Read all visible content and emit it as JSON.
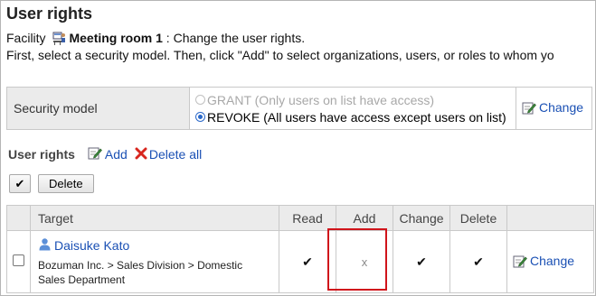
{
  "page": {
    "title": "User rights",
    "facility_label": "Facility",
    "facility_name": "Meeting room 1",
    "facility_suffix": " : Change the user rights.",
    "instruction": "First, select a security model. Then, click \"Add\" to select organizations, users, or roles to whom yo"
  },
  "security_model": {
    "label": "Security model",
    "option_grant": "GRANT (Only users on list have access)",
    "option_revoke": "REVOKE (All users have access except users on list)",
    "selected": "REVOKE",
    "change_label": "Change"
  },
  "user_rights": {
    "label": "User rights",
    "add_label": "Add",
    "delete_all_label": "Delete all"
  },
  "buttons": {
    "select_all_glyph": "✔",
    "delete_label": "Delete"
  },
  "table": {
    "headers": {
      "target": "Target",
      "read": "Read",
      "add": "Add",
      "change": "Change",
      "delete": "Delete"
    },
    "rows": [
      {
        "user_name": "Daisuke Kato",
        "org_line1": "Bozuman Inc. > Sales Division > Domestic",
        "org_line2": "Sales Department",
        "read": "✔",
        "add": "x",
        "change": "✔",
        "delete": "✔",
        "change_link": "Change"
      }
    ]
  },
  "colors": {
    "link": "#1a50b4",
    "highlight": "#d0141b",
    "header_bg": "#ebebeb"
  }
}
